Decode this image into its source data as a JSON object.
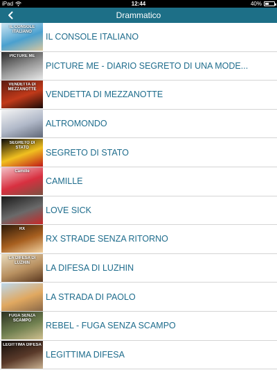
{
  "status_bar": {
    "device": "iPad",
    "time": "12:44",
    "battery": "40%",
    "battery_level": 0.4,
    "icons": [
      "wifi-icon",
      "battery-icon"
    ]
  },
  "nav": {
    "back_icon": "chevron-left-icon",
    "title": "Drammatico"
  },
  "colors": {
    "nav_background": "#1d6f87",
    "item_text": "#1e6c8c",
    "separator": "#d4d4d4"
  },
  "movies": [
    {
      "title": "IL CONSOLE ITALIANO",
      "poster_text": "IL CONSOLE ITALIANO",
      "colors": [
        "#cfe6f2",
        "#4aa0cf",
        "#d8c7a0"
      ]
    },
    {
      "title": "PICTURE ME - DIARIO SEGRETO DI UNA MODE...",
      "poster_text": "PICTURE ME",
      "colors": [
        "#2b2b2b",
        "#9a9a9a",
        "#e8e8e8"
      ]
    },
    {
      "title": "VENDETTA DI MEZZANOTTE",
      "poster_text": "VENDETTA DI MEZZANOTTE",
      "colors": [
        "#5a1a10",
        "#c23a1a",
        "#1a0a06"
      ]
    },
    {
      "title": "ALTROMONDO",
      "poster_text": "",
      "colors": [
        "#f4f4f4",
        "#b0b8c8",
        "#606878"
      ]
    },
    {
      "title": "SEGRETO DI STATO",
      "poster_text": "SEGRETO DI STATO",
      "colors": [
        "#0a0a0a",
        "#f0c020",
        "#c01818"
      ]
    },
    {
      "title": "CAMILLE",
      "poster_text": "Camille",
      "colors": [
        "#f2c2c8",
        "#d83040",
        "#7a5040"
      ]
    },
    {
      "title": "LOVE SICK",
      "poster_text": "",
      "colors": [
        "#1a1a1a",
        "#6a6a6a",
        "#c82828"
      ]
    },
    {
      "title": "RX STRADE SENZA RITORNO",
      "poster_text": "RX",
      "colors": [
        "#2a1808",
        "#a86020",
        "#f0d0a0"
      ]
    },
    {
      "title": "LA DIFESA DI LUZHIN",
      "poster_text": "LA DIFESA DI LUZHIN",
      "colors": [
        "#e8dcc0",
        "#b89060",
        "#5a3820"
      ]
    },
    {
      "title": "LA STRADA DI PAOLO",
      "poster_text": "",
      "colors": [
        "#bcd8ec",
        "#e0a860",
        "#8a6848"
      ]
    },
    {
      "title": "REBEL - FUGA SENZA SCAMPO",
      "poster_text": "FUGA SENZA SCAMPO",
      "colors": [
        "#2a3020",
        "#708050",
        "#d0c090"
      ]
    },
    {
      "title": "LEGITTIMA DIFESA",
      "poster_text": "LEGITTIMA DIFESA",
      "colors": [
        "#100c0a",
        "#5a3a2a",
        "#c8b090"
      ]
    }
  ]
}
